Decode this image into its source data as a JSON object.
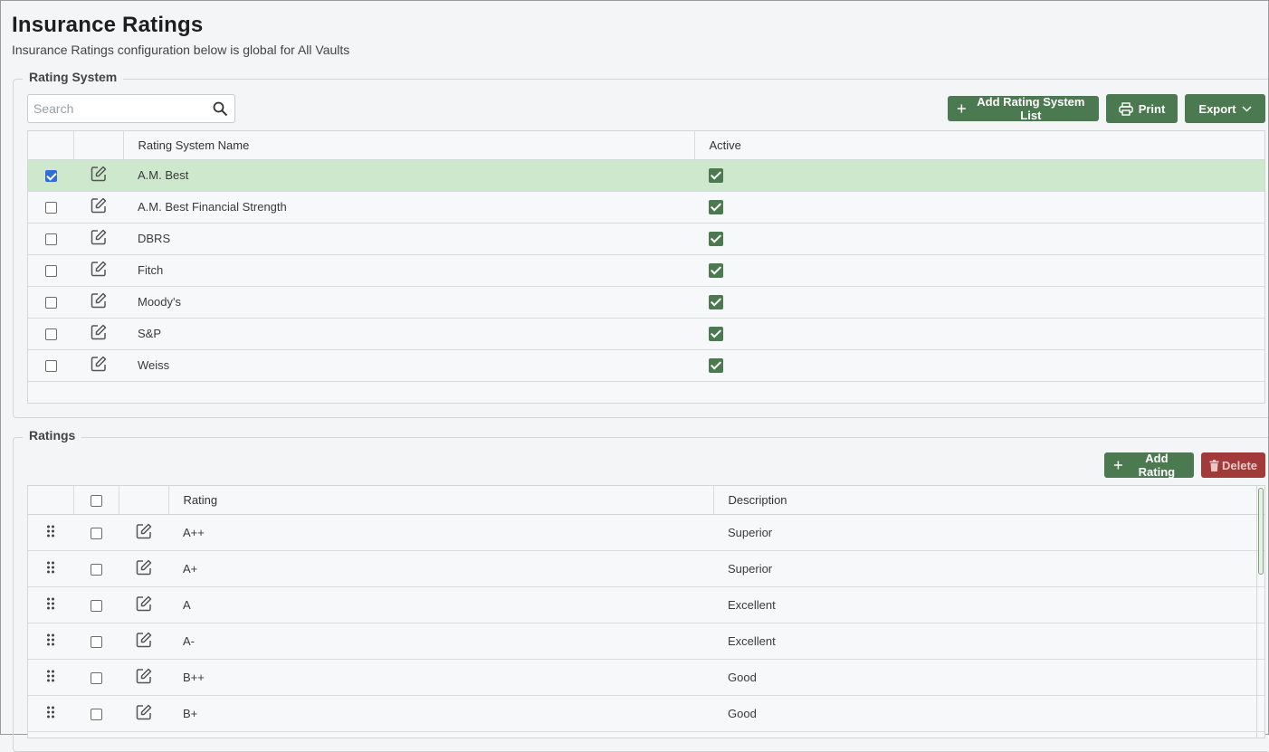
{
  "page": {
    "title": "Insurance Ratings",
    "subtitle": "Insurance Ratings configuration below is global for All Vaults"
  },
  "rating_system": {
    "legend": "Rating System",
    "search_placeholder": "Search",
    "buttons": {
      "add": "Add Rating System List",
      "print": "Print",
      "export": "Export"
    },
    "columns": [
      "",
      "",
      "Rating System Name",
      "Active"
    ],
    "rows": [
      {
        "name": "A.M. Best",
        "active": true,
        "selected": true
      },
      {
        "name": "A.M. Best Financial Strength",
        "active": true,
        "selected": false
      },
      {
        "name": "DBRS",
        "active": true,
        "selected": false
      },
      {
        "name": "Fitch",
        "active": true,
        "selected": false
      },
      {
        "name": "Moody's",
        "active": true,
        "selected": false
      },
      {
        "name": "S&P",
        "active": true,
        "selected": false
      },
      {
        "name": "Weiss",
        "active": true,
        "selected": false
      }
    ]
  },
  "ratings": {
    "legend": "Ratings",
    "buttons": {
      "add": "Add Rating",
      "delete": "Delete"
    },
    "columns": [
      "",
      "",
      "",
      "Rating",
      "Description"
    ],
    "rows": [
      {
        "rating": "A++",
        "description": "Superior"
      },
      {
        "rating": "A+",
        "description": "Superior"
      },
      {
        "rating": "A",
        "description": "Excellent"
      },
      {
        "rating": "A-",
        "description": "Excellent"
      },
      {
        "rating": "B++",
        "description": "Good"
      },
      {
        "rating": "B+",
        "description": "Good"
      }
    ]
  },
  "colors": {
    "primary": "#4b7a50",
    "danger": "#a23a3a",
    "selected_row": "#cde8cc",
    "checkbox_checked": "#2f6fd6"
  }
}
